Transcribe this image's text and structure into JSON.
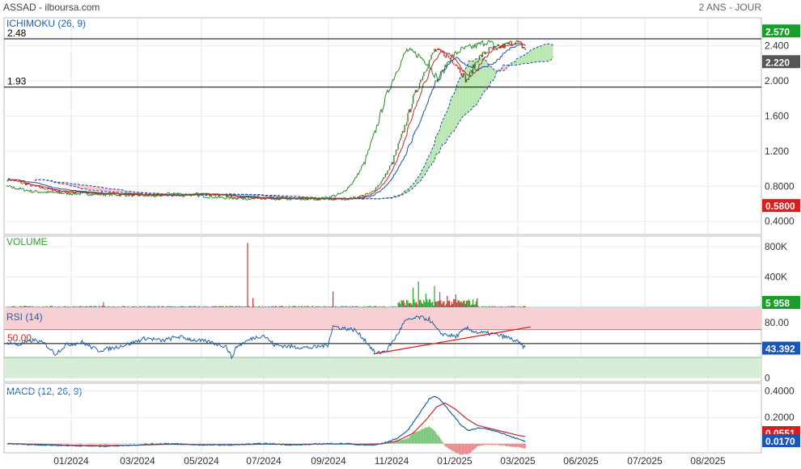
{
  "header": {
    "title": "ASSAD - ilboursa.com",
    "period": "2 ANS - JOUR"
  },
  "colors": {
    "candle_up": "#2e7d32",
    "candle_down": "#c62828",
    "tenkan": "#c62828",
    "kijun": "#1f4e9e",
    "chikou": "#2e8b2e",
    "kumo_bull": "#b8e6b0",
    "kumo_bear": "#f2c4d6",
    "rsi": "#1f5fa8",
    "rsi_overbought": "#f8d0d4",
    "rsi_oversold": "#d6ecd6",
    "macd": "#1f5fa8",
    "signal": "#c62828",
    "hist_pos": "#7cc47c",
    "hist_neg": "#e88a8a",
    "badge_green": "#1a9e2a",
    "badge_red": "#d42020",
    "badge_gray": "#555555",
    "badge_blue": "#1a55b8"
  },
  "chart_data": [
    {
      "type": "line",
      "panel": "ichimoku",
      "title": "ICHIMOKU (26, 9)",
      "x_ticks": [
        "01/2024",
        "03/2024",
        "05/2024",
        "07/2024",
        "09/2024",
        "11/2024",
        "01/2025",
        "03/2025",
        "06/2025",
        "07/2025",
        "08/2025"
      ],
      "y_ticks": [
        "2.400",
        "2.000",
        "1.600",
        "1.200",
        "0.8000",
        "0.4000"
      ],
      "y_tick_values": [
        2.4,
        2.0,
        1.6,
        1.2,
        0.8,
        0.4
      ],
      "ylim": [
        0.25,
        2.72
      ],
      "hlines": [
        {
          "label": "2.48",
          "value": 2.48
        },
        {
          "label": "1.93",
          "value": 1.93
        }
      ],
      "badges": [
        {
          "text": "2.570",
          "value": 2.57,
          "color": "badge_green"
        },
        {
          "text": "2.220",
          "value": 2.22,
          "color": "badge_gray"
        },
        {
          "text": "0.5800",
          "value": 0.58,
          "color": "badge_red"
        }
      ],
      "price_keyframes": [
        [
          0,
          0.88
        ],
        [
          10,
          0.85
        ],
        [
          25,
          0.8
        ],
        [
          50,
          0.74
        ],
        [
          80,
          0.72
        ],
        [
          110,
          0.71
        ],
        [
          140,
          0.7
        ],
        [
          165,
          0.69
        ],
        [
          180,
          0.72
        ],
        [
          200,
          0.7
        ],
        [
          225,
          0.67
        ],
        [
          260,
          0.66
        ],
        [
          280,
          0.66
        ],
        [
          300,
          0.65
        ],
        [
          320,
          0.66
        ],
        [
          326,
          0.67
        ],
        [
          340,
          0.72
        ],
        [
          350,
          0.85
        ],
        [
          360,
          1.05
        ],
        [
          370,
          1.4
        ],
        [
          380,
          1.8
        ],
        [
          390,
          2.1
        ],
        [
          400,
          2.35
        ],
        [
          410,
          2.3
        ],
        [
          420,
          2.2
        ],
        [
          430,
          2.0
        ],
        [
          440,
          2.25
        ],
        [
          450,
          2.35
        ],
        [
          465,
          2.4
        ],
        [
          475,
          2.45
        ],
        [
          480,
          2.42
        ],
        [
          485,
          2.36
        ]
      ],
      "last_index": 485,
      "candle_count": 486
    },
    {
      "type": "bar",
      "panel": "volume",
      "title": "VOLUME",
      "y_ticks": [
        "800K",
        "400K"
      ],
      "y_tick_values": [
        800000,
        400000
      ],
      "ylim": [
        0,
        940000
      ],
      "badge": {
        "text": "5 958",
        "value": 5958,
        "color": "badge_green"
      },
      "spikes": [
        {
          "i": 90,
          "v": 70000
        },
        {
          "i": 225,
          "v": 850000
        },
        {
          "i": 230,
          "v": 120000
        },
        {
          "i": 305,
          "v": 210000
        },
        {
          "i": 380,
          "v": 260000
        },
        {
          "i": 385,
          "v": 340000
        },
        {
          "i": 392,
          "v": 180000
        },
        {
          "i": 400,
          "v": 280000
        },
        {
          "i": 405,
          "v": 200000
        },
        {
          "i": 412,
          "v": 150000
        },
        {
          "i": 420,
          "v": 170000
        },
        {
          "i": 440,
          "v": 120000
        }
      ]
    },
    {
      "type": "line",
      "panel": "rsi",
      "title": "RSI (14)",
      "y_ticks": [
        "80.00",
        "0"
      ],
      "y_tick_values": [
        80,
        0
      ],
      "ylim": [
        -5,
        100
      ],
      "level_label": "50.00",
      "level": 50,
      "overbought": [
        70,
        100
      ],
      "oversold": [
        0,
        30
      ],
      "badge": {
        "text": "43.392",
        "value": 43.392,
        "color": "badge_blue"
      },
      "keyframes": [
        [
          0,
          52
        ],
        [
          10,
          48
        ],
        [
          25,
          55
        ],
        [
          35,
          50
        ],
        [
          45,
          35
        ],
        [
          55,
          48
        ],
        [
          70,
          52
        ],
        [
          85,
          40
        ],
        [
          100,
          44
        ],
        [
          115,
          50
        ],
        [
          130,
          58
        ],
        [
          145,
          54
        ],
        [
          160,
          60
        ],
        [
          175,
          55
        ],
        [
          190,
          52
        ],
        [
          205,
          46
        ],
        [
          210,
          30
        ],
        [
          215,
          46
        ],
        [
          230,
          58
        ],
        [
          240,
          62
        ],
        [
          250,
          48
        ],
        [
          270,
          45
        ],
        [
          285,
          44
        ],
        [
          300,
          48
        ],
        [
          305,
          75
        ],
        [
          315,
          72
        ],
        [
          325,
          70
        ],
        [
          335,
          55
        ],
        [
          345,
          35
        ],
        [
          355,
          40
        ],
        [
          365,
          62
        ],
        [
          372,
          82
        ],
        [
          385,
          88
        ],
        [
          395,
          85
        ],
        [
          405,
          65
        ],
        [
          420,
          60
        ],
        [
          430,
          72
        ],
        [
          440,
          66
        ],
        [
          455,
          64
        ],
        [
          470,
          58
        ],
        [
          478,
          52
        ],
        [
          485,
          43
        ]
      ],
      "trendline": [
        [
          343,
          35
        ],
        [
          490,
          74
        ]
      ]
    },
    {
      "type": "line",
      "panel": "macd",
      "title": "MACD (12, 26, 9)",
      "y_ticks": [
        "0.4000",
        "0.2000"
      ],
      "y_tick_values": [
        0.4,
        0.2
      ],
      "ylim": [
        -0.07,
        0.46
      ],
      "badges": [
        {
          "text": "0.0551",
          "value": 0.0551,
          "color": "badge_red"
        },
        {
          "text": "0.0170",
          "value": 0.017,
          "color": "badge_blue"
        }
      ],
      "macd_keyframes": [
        [
          0,
          0.0
        ],
        [
          30,
          -0.01
        ],
        [
          60,
          -0.015
        ],
        [
          90,
          -0.02
        ],
        [
          120,
          -0.01
        ],
        [
          150,
          0.0
        ],
        [
          180,
          -0.01
        ],
        [
          210,
          -0.01
        ],
        [
          240,
          0.0
        ],
        [
          270,
          -0.01
        ],
        [
          300,
          0.0
        ],
        [
          320,
          0.0
        ],
        [
          330,
          -0.01
        ],
        [
          345,
          -0.01
        ],
        [
          355,
          0.01
        ],
        [
          365,
          0.04
        ],
        [
          375,
          0.1
        ],
        [
          385,
          0.22
        ],
        [
          395,
          0.34
        ],
        [
          400,
          0.36
        ],
        [
          405,
          0.34
        ],
        [
          415,
          0.24
        ],
        [
          425,
          0.14
        ],
        [
          432,
          0.1
        ],
        [
          440,
          0.12
        ],
        [
          450,
          0.11
        ],
        [
          460,
          0.09
        ],
        [
          470,
          0.06
        ],
        [
          480,
          0.03
        ],
        [
          485,
          0.017
        ]
      ],
      "signal_keyframes": [
        [
          0,
          0.0
        ],
        [
          30,
          -0.005
        ],
        [
          60,
          -0.012
        ],
        [
          90,
          -0.015
        ],
        [
          120,
          -0.012
        ],
        [
          150,
          -0.005
        ],
        [
          180,
          -0.007
        ],
        [
          210,
          -0.008
        ],
        [
          240,
          -0.004
        ],
        [
          270,
          -0.006
        ],
        [
          300,
          -0.002
        ],
        [
          330,
          -0.004
        ],
        [
          350,
          -0.002
        ],
        [
          365,
          0.02
        ],
        [
          380,
          0.08
        ],
        [
          392,
          0.18
        ],
        [
          402,
          0.28
        ],
        [
          410,
          0.31
        ],
        [
          420,
          0.26
        ],
        [
          430,
          0.19
        ],
        [
          440,
          0.14
        ],
        [
          450,
          0.12
        ],
        [
          460,
          0.1
        ],
        [
          470,
          0.08
        ],
        [
          480,
          0.06
        ],
        [
          485,
          0.055
        ]
      ]
    }
  ]
}
